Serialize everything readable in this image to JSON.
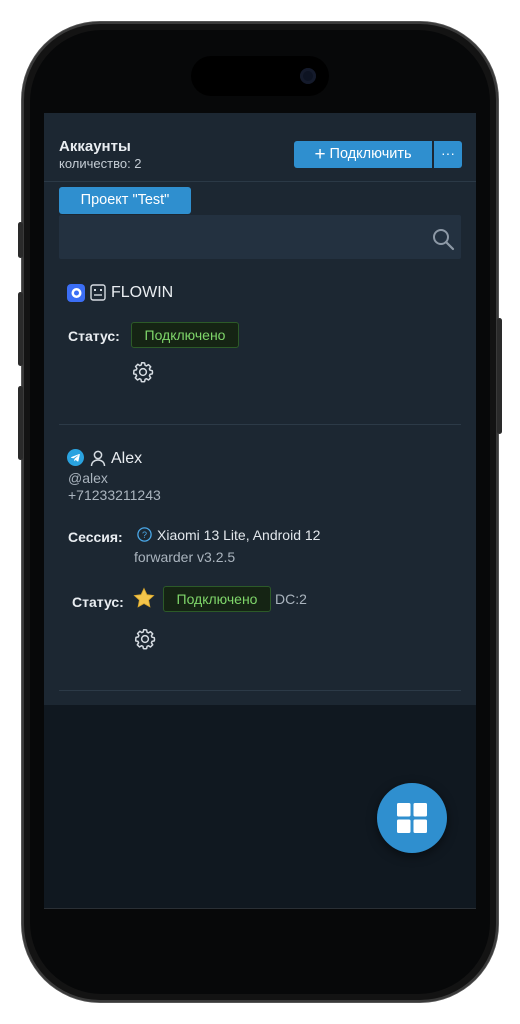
{
  "header": {
    "title": "Аккаунты",
    "count_text": "количество: 2",
    "connect_label": "Подключить",
    "more_label": "···"
  },
  "project": {
    "tag": "Проект \"Test\""
  },
  "search": {
    "placeholder": ""
  },
  "accounts": [
    {
      "type": "flowin",
      "name": "FLOWIN",
      "status_label": "Статус:",
      "status": "Подключено",
      "icons": [
        "flowin-logo-icon",
        "bot-face-icon",
        "gear-icon"
      ]
    },
    {
      "type": "telegram",
      "name": "Alex",
      "username": "@alex",
      "phone": "+71233211243",
      "session_label": "Сессия:",
      "session_device": "Xiaomi 13 Lite, Android 12",
      "session_app": "forwarder v3.2.5",
      "status_label": "Статус:",
      "status": "Подключено",
      "dc": "DC:2",
      "icons": [
        "telegram-icon",
        "user-icon",
        "help-circle-icon",
        "star-icon",
        "gear-icon"
      ]
    }
  ],
  "colors": {
    "accent": "#2f8fcf",
    "panel": "#1c2732",
    "background": "#101820",
    "status_green": "#7fd66a"
  }
}
